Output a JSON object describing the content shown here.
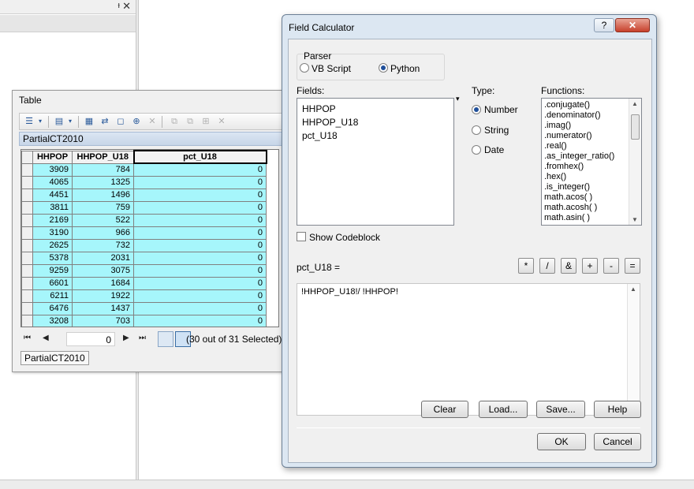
{
  "background": {
    "pin": "ᵻ",
    "close": "✕"
  },
  "table_window": {
    "title": "Table",
    "table_name": "PartialCT2010",
    "columns": [
      "HHPOP",
      "HHPOP_U18",
      "pct_U18"
    ],
    "rows": [
      [
        "3909",
        "784",
        "0"
      ],
      [
        "4065",
        "1325",
        "0"
      ],
      [
        "4451",
        "1496",
        "0"
      ],
      [
        "3811",
        "759",
        "0"
      ],
      [
        "2169",
        "522",
        "0"
      ],
      [
        "3190",
        "966",
        "0"
      ],
      [
        "2625",
        "732",
        "0"
      ],
      [
        "5378",
        "2031",
        "0"
      ],
      [
        "9259",
        "3075",
        "0"
      ],
      [
        "6601",
        "1684",
        "0"
      ],
      [
        "6211",
        "1922",
        "0"
      ],
      [
        "6476",
        "1437",
        "0"
      ],
      [
        "3208",
        "703",
        "0"
      ]
    ],
    "current_record": "0",
    "selection_info": "(30 out of 31 Selected)",
    "footer_tab": "PartialCT2010",
    "highlight_color": "#a6f6fb"
  },
  "dialog": {
    "title": "Field Calculator",
    "help_label": "?",
    "close_label": "✕",
    "parser": {
      "label": "Parser",
      "options": [
        "VB Script",
        "Python"
      ],
      "selected": "Python"
    },
    "fields_label": "Fields:",
    "fields": [
      "HHPOP",
      "HHPOP_U18",
      "pct_U18"
    ],
    "type_label": "Type:",
    "types": [
      "Number",
      "String",
      "Date"
    ],
    "type_selected": "Number",
    "functions_label": "Functions:",
    "functions": [
      ".conjugate()",
      ".denominator()",
      ".imag()",
      ".numerator()",
      ".real()",
      ".as_integer_ratio()",
      ".fromhex()",
      ".hex()",
      ".is_integer()",
      "math.acos( )",
      "math.acosh( )",
      "math.asin( )"
    ],
    "show_codeblock_label": "Show Codeblock",
    "operators": [
      "*",
      "/",
      "&",
      "+",
      "-",
      "="
    ],
    "expression_label": "pct_U18 =",
    "expression": "!HHPOP_U18!/ !HHPOP!",
    "buttons": {
      "clear": "Clear",
      "load": "Load...",
      "save": "Save...",
      "help": "Help",
      "ok": "OK",
      "cancel": "Cancel"
    }
  }
}
